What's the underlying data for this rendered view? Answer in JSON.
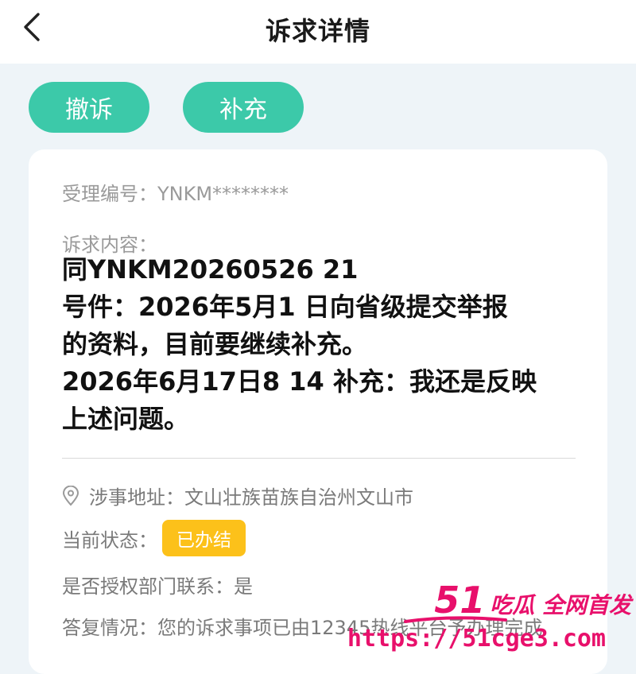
{
  "header": {
    "title": "诉求详情"
  },
  "actions": {
    "withdraw": "撤诉",
    "supplement": "补充"
  },
  "detail": {
    "accept_no": "受理编号：YNKM********",
    "content_label": "诉求内容：",
    "content_lines": [
      "同YNKM20260526 21",
      "号件：2026年5月1 日向省级提交举报",
      "的资料，目前要继续补充。",
      "2026年6月17日8 14 补充：我还是反映",
      "上述问题。"
    ],
    "address": "涉事地址：文山壮族苗族自治州文山市",
    "status_label": "当前状态：",
    "status_value": "已办结",
    "status_color": "#fcc11a",
    "authorize": "是否授权部门联系：是",
    "reply": "答复情况：您的诉求事项已由12345热线平台予办理完成"
  },
  "watermark": {
    "num": "51",
    "brand": "吃瓜 全网首发",
    "url": "https://51cge3.com",
    "color": "#e8106b"
  },
  "theme": {
    "accent": "#3cc9a9",
    "background": "#eef4f8"
  }
}
